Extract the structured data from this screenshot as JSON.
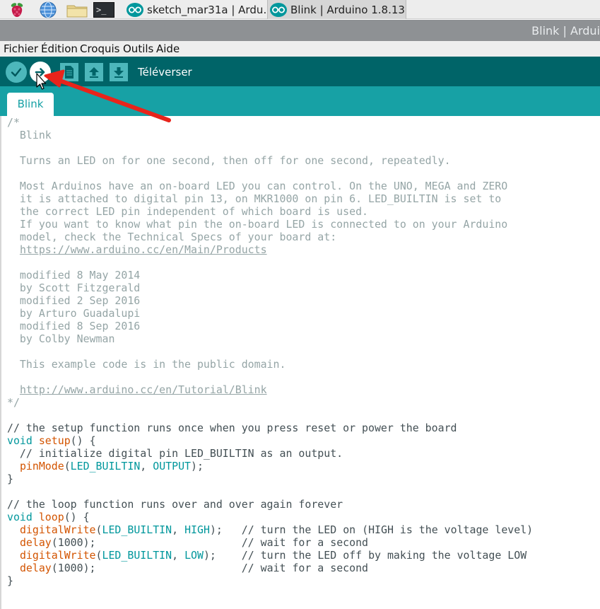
{
  "taskbar": {
    "launchers": [
      {
        "icon": "raspberry-icon"
      },
      {
        "icon": "globe-icon"
      },
      {
        "icon": "folder-icon"
      },
      {
        "icon": "terminal-icon",
        "glyph": ">_"
      }
    ],
    "tasks": [
      {
        "label": "sketch_mar31a | Ardu…",
        "active": false
      },
      {
        "label": "Blink | Arduino 1.8.13",
        "active": true
      }
    ]
  },
  "window": {
    "title": "Blink | Ardui"
  },
  "menubar": {
    "items": [
      "Fichier",
      "Édition",
      "Croquis",
      "Outils",
      "Aide"
    ]
  },
  "toolbar": {
    "buttons": [
      {
        "icon": "checkmark-icon"
      },
      {
        "icon": "arrow-right-icon"
      },
      {
        "icon": "new-file-icon"
      },
      {
        "icon": "arrow-up-icon"
      },
      {
        "icon": "arrow-down-icon"
      }
    ],
    "hover_label": "Téléverser"
  },
  "tabs": [
    "Blink"
  ],
  "colors": {
    "toolbar_bg": "#006468",
    "tab_bg": "#17a1a5",
    "button": "#4db7bb",
    "comment": "#95a5a6",
    "keyword": "#00979c",
    "function": "#d35400",
    "annotation_arrow": "#e8241b"
  },
  "code": {
    "l1": "/*",
    "l2": "  Blink",
    "l3": "  Turns an LED on for one second, then off for one second, repeatedly.",
    "l4": "  Most Arduinos have an on-board LED you can control. On the UNO, MEGA and ZERO",
    "l5": "  it is attached to digital pin 13, on MKR1000 on pin 6. LED_BUILTIN is set to",
    "l6": "  the correct LED pin independent of which board is used.",
    "l7": "  If you want to know what pin the on-board LED is connected to on your Arduino",
    "l8": "  model, check the Technical Specs of your board at:",
    "l9_pre": "  ",
    "l9_link": "https://www.arduino.cc/en/Main/Products",
    "l10": "  modified 8 May 2014",
    "l11": "  by Scott Fitzgerald",
    "l12": "  modified 2 Sep 2016",
    "l13": "  by Arturo Guadalupi",
    "l14": "  modified 8 Sep 2016",
    "l15": "  by Colby Newman",
    "l16": "  This example code is in the public domain.",
    "l17_pre": "  ",
    "l17_link": "http://www.arduino.cc/en/Tutorial/Blink",
    "l18": "*/",
    "setup_comment": "// the setup function runs once when you press reset or power the board",
    "setup_kw": "void",
    "setup_fn": "setup",
    "setup_rest": "() {",
    "init_comment": "  // initialize digital pin LED_BUILTIN as an output.",
    "pm_indent": "  ",
    "pm_fn": "pinMode",
    "pm_open": "(",
    "pm_arg1": "LED_BUILTIN",
    "pm_sep": ", ",
    "pm_arg2": "OUTPUT",
    "pm_close": ");",
    "close1": "}",
    "loop_comment": "// the loop function runs over and over again forever",
    "loop_kw": "void",
    "loop_fn": "loop",
    "loop_rest": "() {",
    "dw1_indent": "  ",
    "dw1_fn": "digitalWrite",
    "dw1_open": "(",
    "dw1_arg1": "LED_BUILTIN",
    "dw1_sep": ", ",
    "dw1_arg2": "HIGH",
    "dw1_close": ");   ",
    "dw1_comment": "// turn the LED on (HIGH is the voltage level)",
    "d1_indent": "  ",
    "d1_fn": "delay",
    "d1_rest": "(1000);                       ",
    "d1_comment": "// wait for a second",
    "dw2_indent": "  ",
    "dw2_fn": "digitalWrite",
    "dw2_open": "(",
    "dw2_arg1": "LED_BUILTIN",
    "dw2_sep": ", ",
    "dw2_arg2": "LOW",
    "dw2_close": ");    ",
    "dw2_comment": "// turn the LED off by making the voltage LOW",
    "d2_indent": "  ",
    "d2_fn": "delay",
    "d2_rest": "(1000);                       ",
    "d2_comment": "// wait for a second",
    "close2": "}"
  }
}
